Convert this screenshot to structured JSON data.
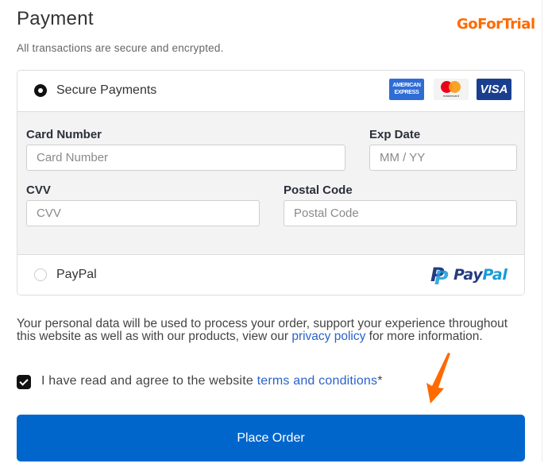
{
  "header": {
    "title": "Payment",
    "subtitle": "All transactions are secure and encrypted.",
    "brand": "GoForTrial"
  },
  "payment_methods": {
    "secure": {
      "label": "Secure Payments",
      "selected": true,
      "card_logos": [
        {
          "name": "American Express",
          "line1": "AMERICAN",
          "line2": "EXPRESS"
        },
        {
          "name": "Mastercard",
          "caption": "mastercard"
        },
        {
          "name": "Visa",
          "text": "VISA"
        }
      ]
    },
    "paypal": {
      "label": "PayPal",
      "selected": false,
      "logo_pay": "Pay",
      "logo_pal": "Pal",
      "logo_p": "P"
    }
  },
  "card_form": {
    "card_number": {
      "label": "Card Number",
      "placeholder": "Card Number",
      "value": ""
    },
    "exp_date": {
      "label": "Exp Date",
      "placeholder": "MM / YY",
      "value": ""
    },
    "cvv": {
      "label": "CVV",
      "placeholder": "CVV",
      "value": ""
    },
    "postal_code": {
      "label": "Postal Code",
      "placeholder": "Postal Code",
      "value": ""
    }
  },
  "privacy": {
    "text_before": "Your personal data will be used to process your order, support your experience throughout this website as well as with our products, view our ",
    "link": "privacy policy",
    "text_after": " for more information."
  },
  "terms": {
    "checked": true,
    "text_before": "I have read and agree to the website ",
    "link": "terms and conditions",
    "required_mark": "*"
  },
  "place_order": {
    "label": "Place Order"
  },
  "colors": {
    "brand": "#ff6a00",
    "button": "#0066cc",
    "link": "#2a62c9",
    "annotation_arrow": "#ff6a00"
  }
}
